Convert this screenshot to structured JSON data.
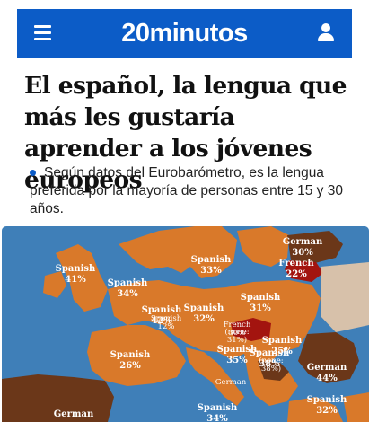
{
  "header": {
    "logo": "20minutos",
    "brand_color": "#0c5cc7"
  },
  "article": {
    "headline": "El español, la lengua que más les gustaría aprender a los jóvenes europeos",
    "lead": "Según datos del Eurobarómetro, es la lengua preferida por la mayoría de personas entre 15 y 30 años."
  },
  "map": {
    "colors": {
      "sea": "#3f7fb8",
      "spanish": "#d9792a",
      "german": "#6b3719",
      "french": "#a3140f"
    },
    "labels": [
      {
        "lang": "Spanish",
        "pct": "41%"
      },
      {
        "lang": "Spanish",
        "pct": "34%"
      },
      {
        "lang": "Spanish",
        "pct": "42%"
      },
      {
        "lang": "Spanish",
        "pct": "33%"
      },
      {
        "lang": "Spanish",
        "pct": "32%"
      },
      {
        "lang": "Spanish",
        "pct": "31%"
      },
      {
        "lang": "Spanish",
        "pct": "26%"
      },
      {
        "lang": "Spanish",
        "pct": "35%"
      },
      {
        "lang": "Spanish",
        "pct": "34%"
      },
      {
        "lang": "Spanish",
        "pct": "38%"
      },
      {
        "lang": "Spanish",
        "pct": "32%"
      },
      {
        "lang": "Spanish",
        "pct": "25%"
      },
      {
        "lang": "German",
        "pct": "30%"
      },
      {
        "lang": "German",
        "pct": "44%"
      },
      {
        "lang": "German",
        "pct": ""
      },
      {
        "lang": "French",
        "pct": "22%"
      },
      {
        "lang": "French",
        "pct": "30%"
      },
      {
        "lang": "(none:",
        "pct": "31%)"
      },
      {
        "lang": "(none:",
        "pct": "38%)"
      },
      {
        "lang": "German",
        "pct": ""
      },
      {
        "lang": "Spanish",
        "pct": "12%"
      }
    ]
  }
}
